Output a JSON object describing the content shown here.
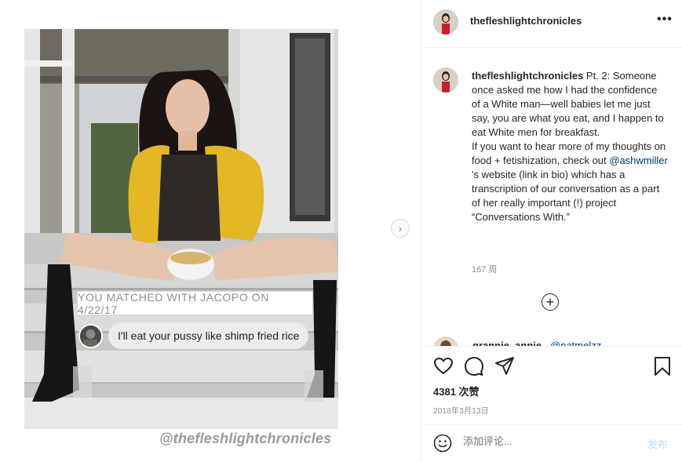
{
  "post": {
    "overlay_match_text": "YOU MATCHED WITH JACOPO ON 4/22/17",
    "overlay_chat_text": "I'll eat your pussy like shimp fried rice",
    "overlay_watermark": "@thefleshlightchronicles",
    "next_arrow": "›"
  },
  "header": {
    "username": "thefleshlightchronicles",
    "more_label": "•••"
  },
  "caption": {
    "username": "thefleshlightchronicles",
    "text_1": " Pt. 2: Someone once asked me how I had the confidence of a White man—well babies let me just say, you are what you eat, and I happen to eat White men for breakfast.",
    "text_2": "If you want to hear more of my thoughts on food + fetishization, check out ",
    "mention": "@ashwmiller",
    "text_3": " 's website (link in bio) which has a transcription of our conversation as a part of her really important (!) project “Conversations With.”",
    "time": "167 周"
  },
  "load_more": "+",
  "next_comment": {
    "username": "grannie_annie_",
    "mention": "@natmelzz"
  },
  "actions": {
    "like_icon": "heart-icon",
    "comment_icon": "comment-icon",
    "share_icon": "share-icon",
    "save_icon": "bookmark-icon",
    "likes": "4381 次赞",
    "date": "2018年3月13日"
  },
  "comment_box": {
    "placeholder": "添加评论...",
    "post_label": "发布",
    "emoji_icon": "smiley-icon"
  },
  "colors": {
    "link": "#00376b",
    "post_button": "#b2dffc",
    "muted": "#8e8e8e"
  }
}
